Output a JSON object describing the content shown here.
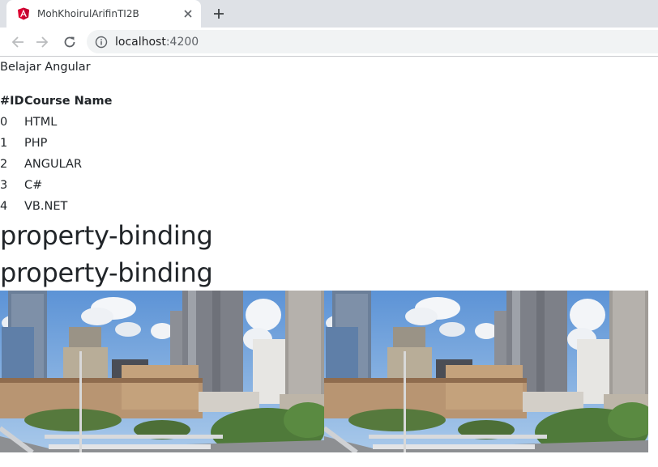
{
  "browser": {
    "tab": {
      "title": "MohKhoirulArifinTI2B",
      "favicon": "angular-icon",
      "favicon_color": "#dd0031"
    },
    "address": {
      "host": "localhost",
      "port": ":4200"
    }
  },
  "page": {
    "title": "Belajar Angular",
    "table": {
      "headers": [
        "#ID",
        "Course Name"
      ],
      "rows": [
        [
          "0",
          "HTML"
        ],
        [
          "1",
          "PHP"
        ],
        [
          "2",
          "ANGULAR"
        ],
        [
          "3",
          "C#"
        ],
        [
          "4",
          "VB.NET"
        ]
      ]
    },
    "headings": [
      "property-binding",
      "property-binding"
    ],
    "images": [
      {
        "name": "city-skyline-photo"
      },
      {
        "name": "city-skyline-photo"
      }
    ]
  },
  "colors": {
    "sky": "#6fa0d8",
    "foliage": "#4f7a3a",
    "text": "#212529"
  }
}
